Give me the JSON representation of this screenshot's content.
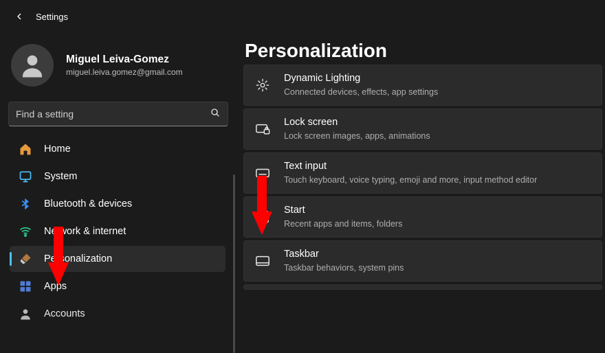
{
  "app": {
    "title": "Settings"
  },
  "user": {
    "name": "Miguel Leiva-Gomez",
    "email": "miguel.leiva.gomez@gmail.com"
  },
  "search": {
    "placeholder": "Find a setting"
  },
  "sidebar": {
    "items": [
      {
        "label": "Home"
      },
      {
        "label": "System"
      },
      {
        "label": "Bluetooth & devices"
      },
      {
        "label": "Network & internet"
      },
      {
        "label": "Personalization"
      },
      {
        "label": "Apps"
      },
      {
        "label": "Accounts"
      }
    ]
  },
  "page": {
    "title": "Personalization"
  },
  "cards": [
    {
      "title": "Dynamic Lighting",
      "sub": "Connected devices, effects, app settings"
    },
    {
      "title": "Lock screen",
      "sub": "Lock screen images, apps, animations"
    },
    {
      "title": "Text input",
      "sub": "Touch keyboard, voice typing, emoji and more, input method editor"
    },
    {
      "title": "Start",
      "sub": "Recent apps and items, folders"
    },
    {
      "title": "Taskbar",
      "sub": "Taskbar behaviors, system pins"
    }
  ]
}
